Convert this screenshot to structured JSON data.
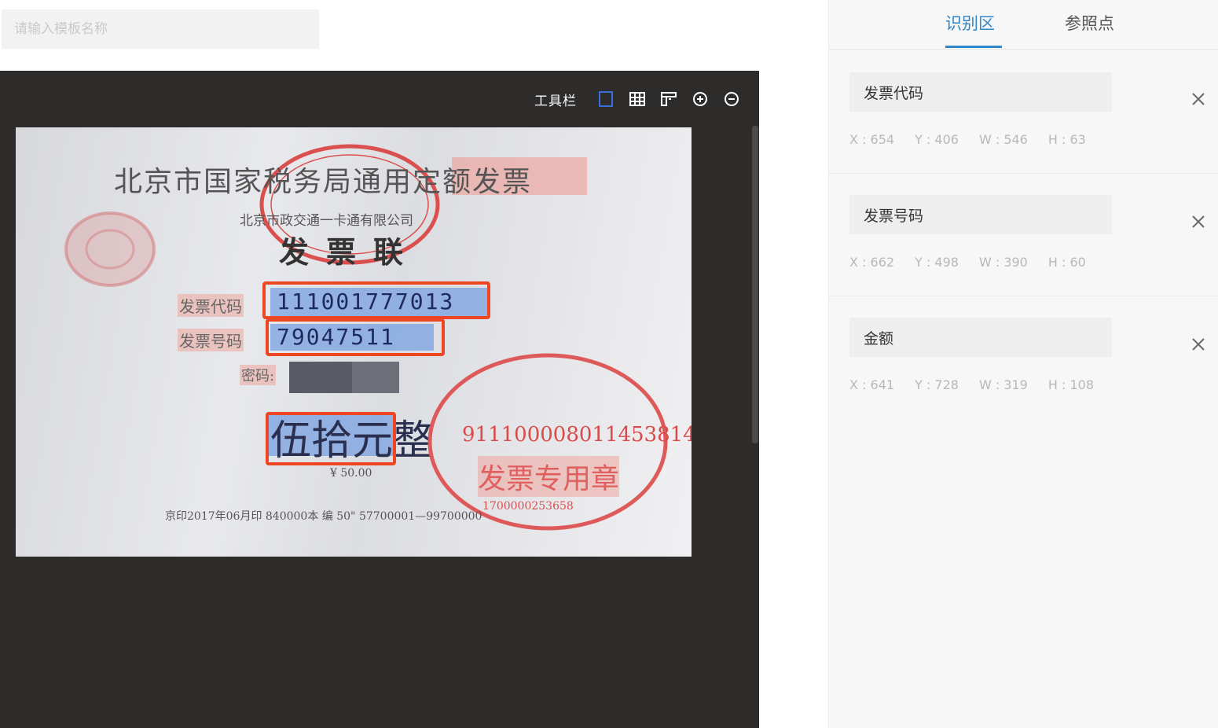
{
  "template_name": {
    "placeholder": "请输入模板名称",
    "value": ""
  },
  "toolbar": {
    "label": "工具栏",
    "buttons": [
      {
        "name": "rect-select-icon",
        "active": true
      },
      {
        "name": "table-icon"
      },
      {
        "name": "layout-icon"
      },
      {
        "name": "zoom-in-icon"
      },
      {
        "name": "zoom-out-icon"
      }
    ]
  },
  "invoice": {
    "title": "北京市国家税务局通用定额发票",
    "company": "北京市政交通一卡通有限公司",
    "copy_label": "发票联",
    "code_label": "发票代码",
    "code_value": "111001777013",
    "number_label": "发票号码",
    "number_value": "79047511",
    "mima_label": "密码:",
    "amount_text": "伍拾元整",
    "amount_small": "¥ 50.00",
    "footer": "京印2017年06月印 840000本 编 50\" 57700001—99700000",
    "stamp_number": "911100008011453814",
    "stamp_text": "发票专用章",
    "stamp_serial": "1700000253658"
  },
  "panel": {
    "tabs": [
      {
        "label": "识别区",
        "active": true
      },
      {
        "label": "参照点",
        "active": false
      }
    ],
    "regions": [
      {
        "name": "发票代码",
        "x": "X : 654",
        "y": "Y : 406",
        "w": "W : 546",
        "h": "H : 63"
      },
      {
        "name": "发票号码",
        "x": "X : 662",
        "y": "Y : 498",
        "w": "W : 390",
        "h": "H : 60"
      },
      {
        "name": "金额",
        "x": "X : 641",
        "y": "Y : 728",
        "w": "W : 319",
        "h": "H : 108"
      }
    ]
  },
  "colors": {
    "accent": "#2f86c9",
    "selection": "#ee4523",
    "viewer_bg": "#2e2b2b"
  }
}
